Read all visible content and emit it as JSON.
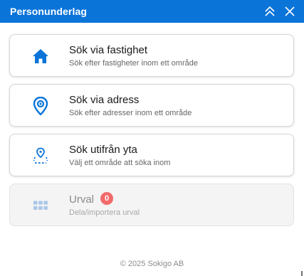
{
  "panel": {
    "title": "Personunderlag"
  },
  "header_icons": {
    "collapse": "double-chevron-up-icon",
    "close": "close-icon"
  },
  "options": [
    {
      "title": "Sök via fastighet",
      "subtitle": "Sök efter fastigheter inom ett område",
      "icon": "home-icon"
    },
    {
      "title": "Sök via adress",
      "subtitle": "Sök efter adresser inom ett område",
      "icon": "location-pin-icon"
    },
    {
      "title": "Sök utifrån yta",
      "subtitle": "Välj ett område att söka inom",
      "icon": "area-pin-icon"
    },
    {
      "title": "Urval",
      "subtitle": "Dela/importera urval",
      "icon": "grid-selection-icon",
      "badge": "0",
      "disabled": true
    }
  ],
  "footer": {
    "copyright": "© 2025 Sokigo AB"
  },
  "colors": {
    "accent": "#0b74d9",
    "badge": "#f26b6b",
    "disabled_icon": "#a9c6e8"
  }
}
